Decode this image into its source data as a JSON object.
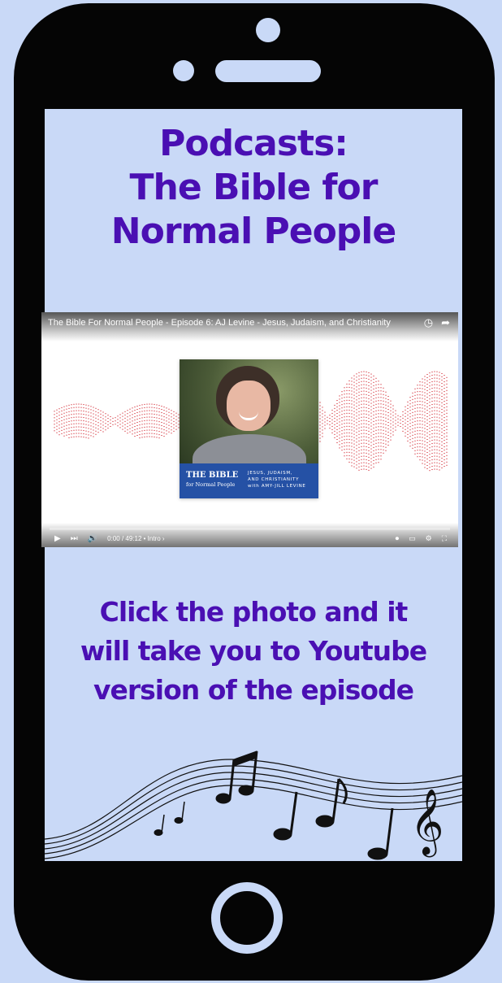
{
  "heading": {
    "line1": "Podcasts:",
    "line2": "The Bible for",
    "line3": "Normal People"
  },
  "video": {
    "title": "The Bible For Normal People - Episode 6: AJ Levine - Jesus, Judaism, and Christianity",
    "watch_later_icon": "clock-icon",
    "share_icon": "share-icon",
    "thumbnail": {
      "logo_line1": "THE BIBLE",
      "logo_line2": "for Normal People",
      "episode_line1": "JESUS, JUDAISM,",
      "episode_line2": "AND CHRISTIANITY",
      "episode_line3": "with AMY-JILL LEVINE"
    },
    "time": "0:00 / 49:12 • Intro ›",
    "progress": 0.0
  },
  "instructions": {
    "line1": "Click the photo and it",
    "line2": "will take you to Youtube",
    "line3": "version of the episode"
  },
  "colors": {
    "background": "#c9d9f7",
    "phone": "#050505",
    "heading": "#4a0fb3",
    "wave": "#e3797f",
    "banner": "#2551a5"
  }
}
